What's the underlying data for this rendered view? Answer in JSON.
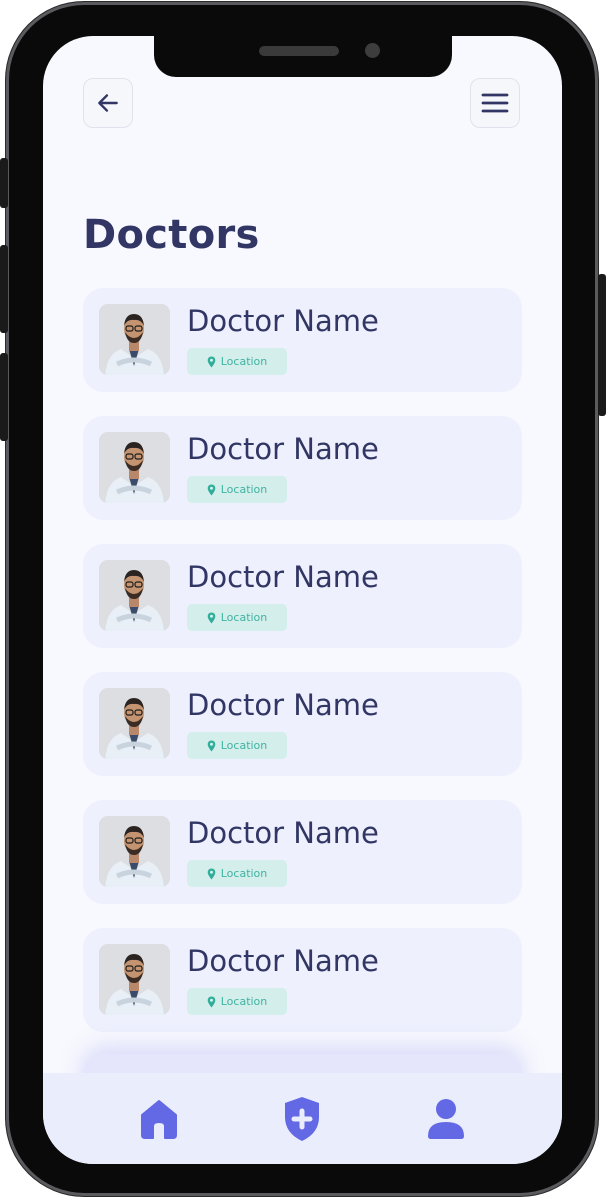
{
  "header": {
    "back_icon": "arrow-left-icon",
    "menu_icon": "hamburger-menu-icon"
  },
  "page": {
    "title": "Doctors"
  },
  "doctors": [
    {
      "name": "Doctor Name",
      "location": "Location"
    },
    {
      "name": "Doctor Name",
      "location": "Location"
    },
    {
      "name": "Doctor Name",
      "location": "Location"
    },
    {
      "name": "Doctor Name",
      "location": "Location"
    },
    {
      "name": "Doctor Name",
      "location": "Location"
    },
    {
      "name": "Doctor Name",
      "location": "Location"
    }
  ],
  "bottom_nav": {
    "items": [
      {
        "icon": "home-icon"
      },
      {
        "icon": "shield-plus-icon"
      },
      {
        "icon": "user-icon"
      }
    ]
  },
  "colors": {
    "primary_text": "#323665",
    "accent": "#6368e4",
    "card_bg": "#eef1fd",
    "location_badge_bg": "#d4eeeb",
    "location_text": "#3fb3a1",
    "screen_bg": "#f8f9fe"
  }
}
